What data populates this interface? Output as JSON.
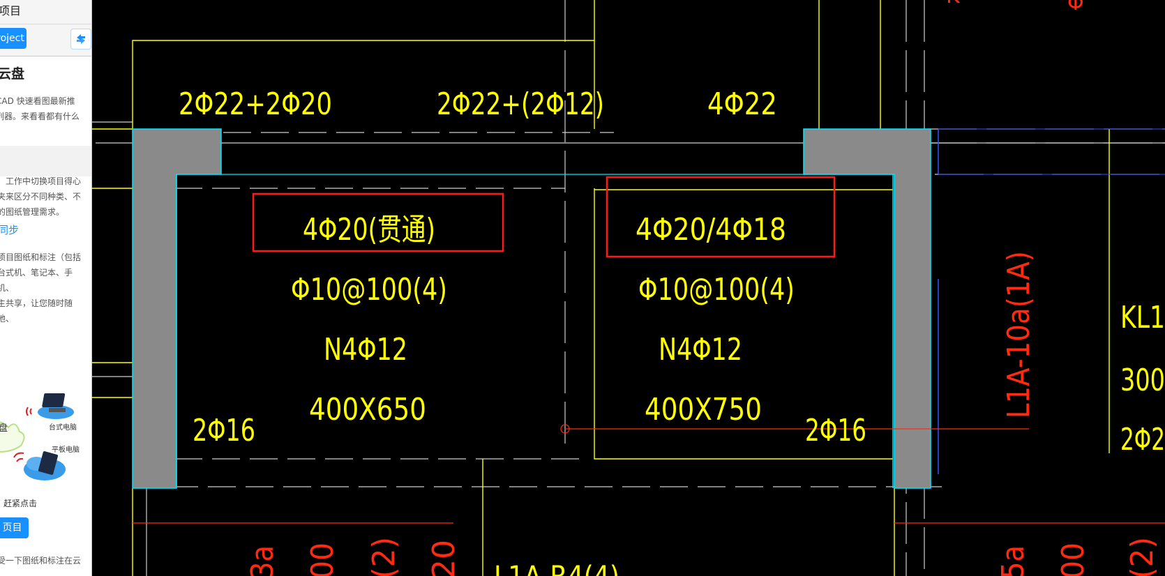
{
  "panel": {
    "header_title": "项目",
    "project_button": "roject",
    "cloud_title": "云盘",
    "intro_lines": [
      "CAD 快速看图最新推",
      "列器。来看看都有什么"
    ],
    "section1_lines": [
      "，工作中切换项目得心",
      "夹来区分不同种类、不",
      "的图纸管理需求。"
    ],
    "section2_title": "同步",
    "section3_lines": [
      "项目图纸和标注（包括",
      "台式机、笔记本、手机、",
      "主共享，让您随时随地、"
    ],
    "illus_cloud_label": "盘",
    "illus_desktop_label": "台式电脑",
    "illus_tablet_label": "平板电脑",
    "hurry_text": "赶紧点击",
    "open_button": "页目",
    "bottom_text": "受一下图纸和标注在云"
  },
  "drawing": {
    "labels": {
      "top_left_rebar": "2Φ22+2Φ20",
      "top_mid_rebar": "2Φ22+(2Φ12)",
      "top_right_rebar": "4Φ22",
      "left_bottom_rebar": "4Φ20(贯通)",
      "right_bottom_rebar": "4Φ20/4Φ18",
      "left_stirrup": "Φ10@100(4)",
      "right_stirrup": "Φ10@100(4)",
      "left_side_bar": "N4Φ12",
      "right_side_bar": "N4Φ12",
      "left_section": "400X650",
      "right_section": "400X750",
      "left_corner_bar": "2Φ16",
      "right_corner_bar": "2Φ16",
      "right_beam_id": "KL1",
      "right_beam_dim": "300",
      "right_beam_rebar": "2Φ2",
      "vertical_red": "L1A-10a(1A)",
      "bottom_red_1": "3a",
      "bottom_red_2": "00",
      "bottom_red_3": "(2)",
      "bottom_red_4": "20",
      "bottom_yellow": "L1A-R4(4)",
      "bottom_red_5": "5a",
      "bottom_red_6": "00",
      "bottom_red_7": "(2)",
      "top_red_1": "K",
      "top_red_2": "Φ"
    },
    "colors": {
      "background": "#000000",
      "yellow": "#ffff00",
      "red": "#ff2a10",
      "cyan": "#00e5ff",
      "white": "#ffffff",
      "wall": "#8a8a8a",
      "highlight": "#ff1a1a",
      "blue": "#3050ff"
    }
  }
}
